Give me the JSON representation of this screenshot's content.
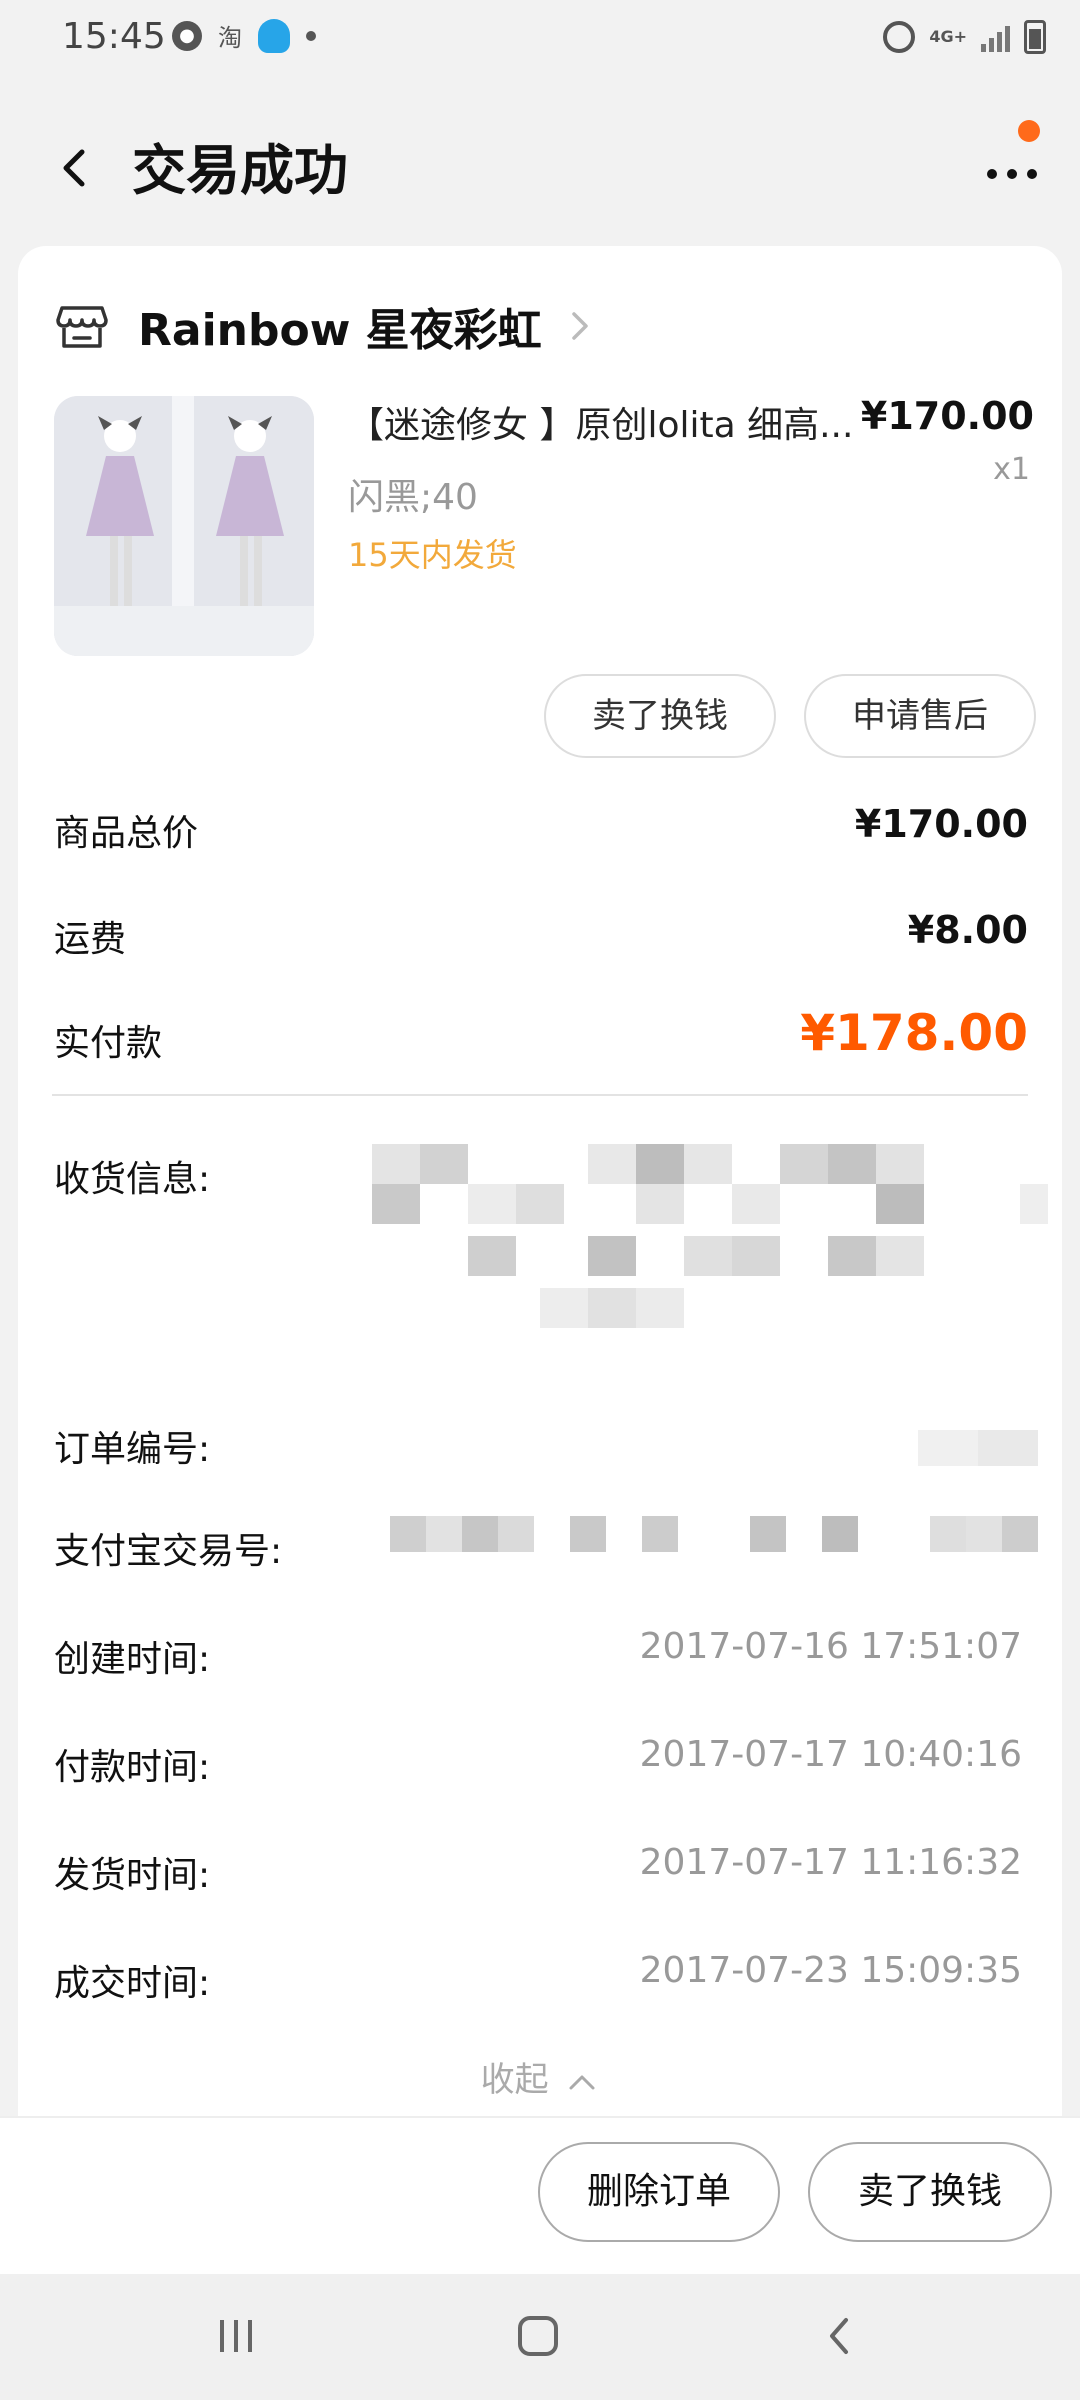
{
  "status_bar": {
    "time": "15:45",
    "icons_left": [
      "account-icon",
      "taobao-icon",
      "qq-icon",
      "dot-icon"
    ],
    "network": "4G+",
    "icons_right": [
      "alarm-icon",
      "network-icon",
      "signal-icon",
      "battery-icon"
    ]
  },
  "header": {
    "title": "交易成功"
  },
  "shop": {
    "name": "Rainbow 星夜彩虹"
  },
  "product": {
    "title": "【迷途修女 】原创lolita  细高...",
    "price": "¥170.00",
    "quantity": "x1",
    "sku": "闪黑;40",
    "shipping_note": "15天内发货"
  },
  "actions": {
    "sell_exchange": "卖了换钱",
    "after_sale": "申请售后"
  },
  "summary": {
    "goods_total_label": "商品总价",
    "goods_total_value": "¥170.00",
    "shipping_label": "运费",
    "shipping_value": "¥8.00",
    "paid_label": "实付款",
    "paid_value": "¥178.00"
  },
  "info": {
    "address_label": "收货信息:",
    "order_no_label": "订单编号:",
    "alipay_no_label": "支付宝交易号:",
    "created_label": "创建时间:",
    "created_value": "2017-07-16 17:51:07",
    "paid_time_label": "付款时间:",
    "paid_time_value": "2017-07-17 10:40:16",
    "shipped_label": "发货时间:",
    "shipped_value": "2017-07-17 11:16:32",
    "closed_label": "成交时间:",
    "closed_value": "2017-07-23 15:09:35"
  },
  "collapse_label": "收起",
  "bottom": {
    "delete_order": "删除订单",
    "sell_exchange": "卖了换钱"
  },
  "colors": {
    "accent": "#ff5a00",
    "shipping_note": "#f2a93b",
    "notification": "#ff6a1a"
  }
}
